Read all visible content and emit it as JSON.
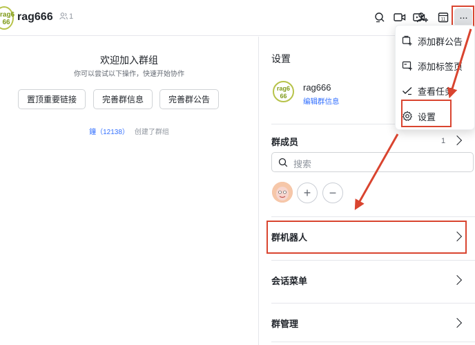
{
  "header": {
    "group_avatar_text": "rag6\n66",
    "group_name": "rag666",
    "member_count": "1",
    "icons": [
      "search-icon",
      "video-call-icon",
      "screen-share-icon",
      "add-member-icon",
      "calendar-icon",
      "more-icon"
    ],
    "more_label": "···",
    "calendar_digit": "11"
  },
  "welcome": {
    "title": "欢迎加入群组",
    "subtitle": "你可以尝试以下操作，快速开始协作",
    "actions": [
      "置顶重要链接",
      "完善群信息",
      "完善群公告"
    ],
    "creator_name": "鐘（12138）",
    "creator_suffix": "创建了群组"
  },
  "settings": {
    "title": "设置",
    "group_avatar_text": "rag6\n66",
    "group_name": "rag666",
    "edit_link": "编辑群信息",
    "members_label": "群成员",
    "members_count": "1",
    "search_placeholder": "搜索",
    "add_label": "+",
    "remove_label": "−",
    "robot_label": "群机器人",
    "menu_label": "会话菜单",
    "manage_label": "群管理"
  },
  "dropdown": {
    "items": [
      {
        "label": "添加群公告",
        "icon": "announcement-icon"
      },
      {
        "label": "添加标签页",
        "icon": "tab-add-icon"
      },
      {
        "label": "查看任务",
        "icon": "task-check-icon"
      },
      {
        "label": "设置",
        "icon": "gear-icon"
      }
    ]
  },
  "colors": {
    "annotation": "#d9442f",
    "link": "#3370ff",
    "avatar_border": "#b7c34a"
  }
}
